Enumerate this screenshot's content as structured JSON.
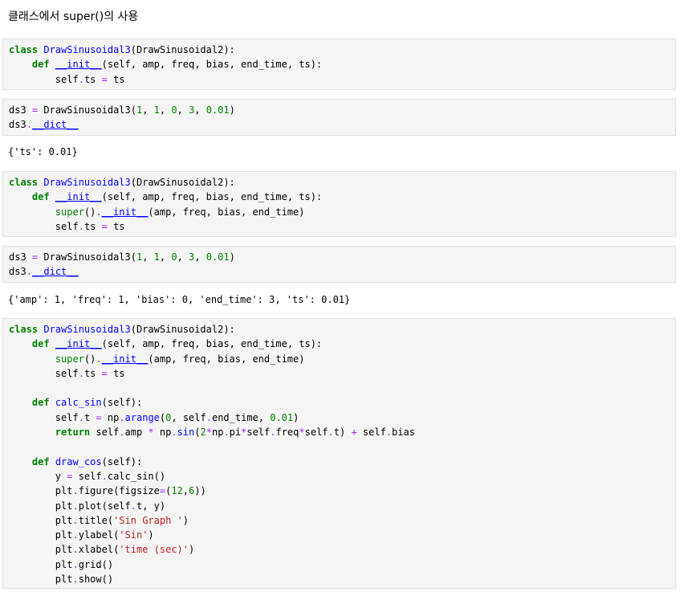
{
  "heading": "클래스에서 super()의 사용",
  "cells": [
    {
      "kind": "code",
      "lines": [
        [
          [
            "kw",
            "class"
          ],
          [
            "pl",
            " "
          ],
          [
            "cls",
            "DrawSinusoidal3"
          ],
          [
            "pl",
            "(DrawSinusoidal2):"
          ]
        ],
        [
          [
            "pl",
            "    "
          ],
          [
            "kw",
            "def"
          ],
          [
            "pl",
            " "
          ],
          [
            "dn",
            "__init__"
          ],
          [
            "pl",
            "(self, amp, freq, bias, end_time, ts):"
          ]
        ],
        [
          [
            "pl",
            "        self"
          ],
          [
            "op",
            "."
          ],
          [
            "pl",
            "ts "
          ],
          [
            "op",
            "="
          ],
          [
            "pl",
            " ts"
          ]
        ]
      ]
    },
    {
      "kind": "code",
      "lines": [
        [
          [
            "pl",
            "ds3 "
          ],
          [
            "op",
            "="
          ],
          [
            "pl",
            " DrawSinusoidal3("
          ],
          [
            "num",
            "1"
          ],
          [
            "pl",
            ", "
          ],
          [
            "num",
            "1"
          ],
          [
            "pl",
            ", "
          ],
          [
            "num",
            "0"
          ],
          [
            "pl",
            ", "
          ],
          [
            "num",
            "3"
          ],
          [
            "pl",
            ", "
          ],
          [
            "num",
            "0.01"
          ],
          [
            "pl",
            ")"
          ]
        ],
        [
          [
            "pl",
            "ds3"
          ],
          [
            "op",
            "."
          ],
          [
            "dn",
            "__dict__"
          ]
        ]
      ]
    },
    {
      "kind": "output",
      "text": "{'ts': 0.01}"
    },
    {
      "kind": "code",
      "lines": [
        [
          [
            "kw",
            "class"
          ],
          [
            "pl",
            " "
          ],
          [
            "cls",
            "DrawSinusoidal3"
          ],
          [
            "pl",
            "(DrawSinusoidal2):"
          ]
        ],
        [
          [
            "pl",
            "    "
          ],
          [
            "kw",
            "def"
          ],
          [
            "pl",
            " "
          ],
          [
            "dn",
            "__init__"
          ],
          [
            "pl",
            "(self, amp, freq, bias, end_time, ts):"
          ]
        ],
        [
          [
            "pl",
            "        "
          ],
          [
            "bi",
            "super"
          ],
          [
            "pl",
            "()"
          ],
          [
            "op",
            "."
          ],
          [
            "dn",
            "__init__"
          ],
          [
            "pl",
            "(amp, freq, bias, end_time)"
          ]
        ],
        [
          [
            "pl",
            "        self"
          ],
          [
            "op",
            "."
          ],
          [
            "pl",
            "ts "
          ],
          [
            "op",
            "="
          ],
          [
            "pl",
            " ts"
          ]
        ]
      ]
    },
    {
      "kind": "code",
      "lines": [
        [
          [
            "pl",
            "ds3 "
          ],
          [
            "op",
            "="
          ],
          [
            "pl",
            " DrawSinusoidal3("
          ],
          [
            "num",
            "1"
          ],
          [
            "pl",
            ", "
          ],
          [
            "num",
            "1"
          ],
          [
            "pl",
            ", "
          ],
          [
            "num",
            "0"
          ],
          [
            "pl",
            ", "
          ],
          [
            "num",
            "3"
          ],
          [
            "pl",
            ", "
          ],
          [
            "num",
            "0.01"
          ],
          [
            "pl",
            ")"
          ]
        ],
        [
          [
            "pl",
            "ds3"
          ],
          [
            "op",
            "."
          ],
          [
            "dn",
            "__dict__"
          ]
        ]
      ]
    },
    {
      "kind": "output",
      "text": "{'amp': 1, 'freq': 1, 'bias': 0, 'end_time': 3, 'ts': 0.01}"
    },
    {
      "kind": "code",
      "lines": [
        [
          [
            "kw",
            "class"
          ],
          [
            "pl",
            " "
          ],
          [
            "cls",
            "DrawSinusoidal3"
          ],
          [
            "pl",
            "(DrawSinusoidal2):"
          ]
        ],
        [
          [
            "pl",
            "    "
          ],
          [
            "kw",
            "def"
          ],
          [
            "pl",
            " "
          ],
          [
            "dn",
            "__init__"
          ],
          [
            "pl",
            "(self, amp, freq, bias, end_time, ts):"
          ]
        ],
        [
          [
            "pl",
            "        "
          ],
          [
            "bi",
            "super"
          ],
          [
            "pl",
            "()"
          ],
          [
            "op",
            "."
          ],
          [
            "dn",
            "__init__"
          ],
          [
            "pl",
            "(amp, freq, bias, end_time)"
          ]
        ],
        [
          [
            "pl",
            "        self"
          ],
          [
            "op",
            "."
          ],
          [
            "pl",
            "ts "
          ],
          [
            "op",
            "="
          ],
          [
            "pl",
            " ts"
          ]
        ],
        [
          [
            "pl",
            ""
          ]
        ],
        [
          [
            "pl",
            "    "
          ],
          [
            "kw",
            "def"
          ],
          [
            "pl",
            " "
          ],
          [
            "fn",
            "calc_sin"
          ],
          [
            "pl",
            "(self):"
          ]
        ],
        [
          [
            "pl",
            "        self"
          ],
          [
            "op",
            "."
          ],
          [
            "pl",
            "t "
          ],
          [
            "op",
            "="
          ],
          [
            "pl",
            " np"
          ],
          [
            "op",
            "."
          ],
          [
            "fn",
            "arange"
          ],
          [
            "pl",
            "("
          ],
          [
            "num",
            "0"
          ],
          [
            "pl",
            ", self"
          ],
          [
            "op",
            "."
          ],
          [
            "pl",
            "end_time, "
          ],
          [
            "num",
            "0.01"
          ],
          [
            "pl",
            ")"
          ]
        ],
        [
          [
            "pl",
            "        "
          ],
          [
            "kw",
            "return"
          ],
          [
            "pl",
            " self"
          ],
          [
            "op",
            "."
          ],
          [
            "pl",
            "amp "
          ],
          [
            "op",
            "*"
          ],
          [
            "pl",
            " np"
          ],
          [
            "op",
            "."
          ],
          [
            "fn",
            "sin"
          ],
          [
            "pl",
            "("
          ],
          [
            "num",
            "2"
          ],
          [
            "op",
            "*"
          ],
          [
            "pl",
            "np"
          ],
          [
            "op",
            "."
          ],
          [
            "pl",
            "pi"
          ],
          [
            "op",
            "*"
          ],
          [
            "pl",
            "self"
          ],
          [
            "op",
            "."
          ],
          [
            "pl",
            "freq"
          ],
          [
            "op",
            "*"
          ],
          [
            "pl",
            "self"
          ],
          [
            "op",
            "."
          ],
          [
            "pl",
            "t) "
          ],
          [
            "op",
            "+"
          ],
          [
            "pl",
            " self"
          ],
          [
            "op",
            "."
          ],
          [
            "pl",
            "bias"
          ]
        ],
        [
          [
            "pl",
            ""
          ]
        ],
        [
          [
            "pl",
            "    "
          ],
          [
            "kw",
            "def"
          ],
          [
            "pl",
            " "
          ],
          [
            "fn",
            "draw_cos"
          ],
          [
            "pl",
            "(self):"
          ]
        ],
        [
          [
            "pl",
            "        y "
          ],
          [
            "op",
            "="
          ],
          [
            "pl",
            " self"
          ],
          [
            "op",
            "."
          ],
          [
            "pl",
            "calc_sin()"
          ]
        ],
        [
          [
            "pl",
            "        plt"
          ],
          [
            "op",
            "."
          ],
          [
            "pl",
            "figure(figsize"
          ],
          [
            "op",
            "="
          ],
          [
            "pl",
            "("
          ],
          [
            "num",
            "12"
          ],
          [
            "pl",
            ","
          ],
          [
            "num",
            "6"
          ],
          [
            "pl",
            "))"
          ]
        ],
        [
          [
            "pl",
            "        plt"
          ],
          [
            "op",
            "."
          ],
          [
            "pl",
            "plot(self"
          ],
          [
            "op",
            "."
          ],
          [
            "pl",
            "t, y)"
          ]
        ],
        [
          [
            "pl",
            "        plt"
          ],
          [
            "op",
            "."
          ],
          [
            "pl",
            "title("
          ],
          [
            "str",
            "'Sin Graph '"
          ],
          [
            "pl",
            ")"
          ]
        ],
        [
          [
            "pl",
            "        plt"
          ],
          [
            "op",
            "."
          ],
          [
            "pl",
            "ylabel("
          ],
          [
            "str",
            "'Sin'"
          ],
          [
            "pl",
            ")"
          ]
        ],
        [
          [
            "pl",
            "        plt"
          ],
          [
            "op",
            "."
          ],
          [
            "pl",
            "xlabel("
          ],
          [
            "str",
            "'time (sec)'"
          ],
          [
            "pl",
            ")"
          ]
        ],
        [
          [
            "pl",
            "        plt"
          ],
          [
            "op",
            "."
          ],
          [
            "pl",
            "grid()"
          ]
        ],
        [
          [
            "pl",
            "        plt"
          ],
          [
            "op",
            "."
          ],
          [
            "pl",
            "show()"
          ]
        ]
      ]
    }
  ]
}
